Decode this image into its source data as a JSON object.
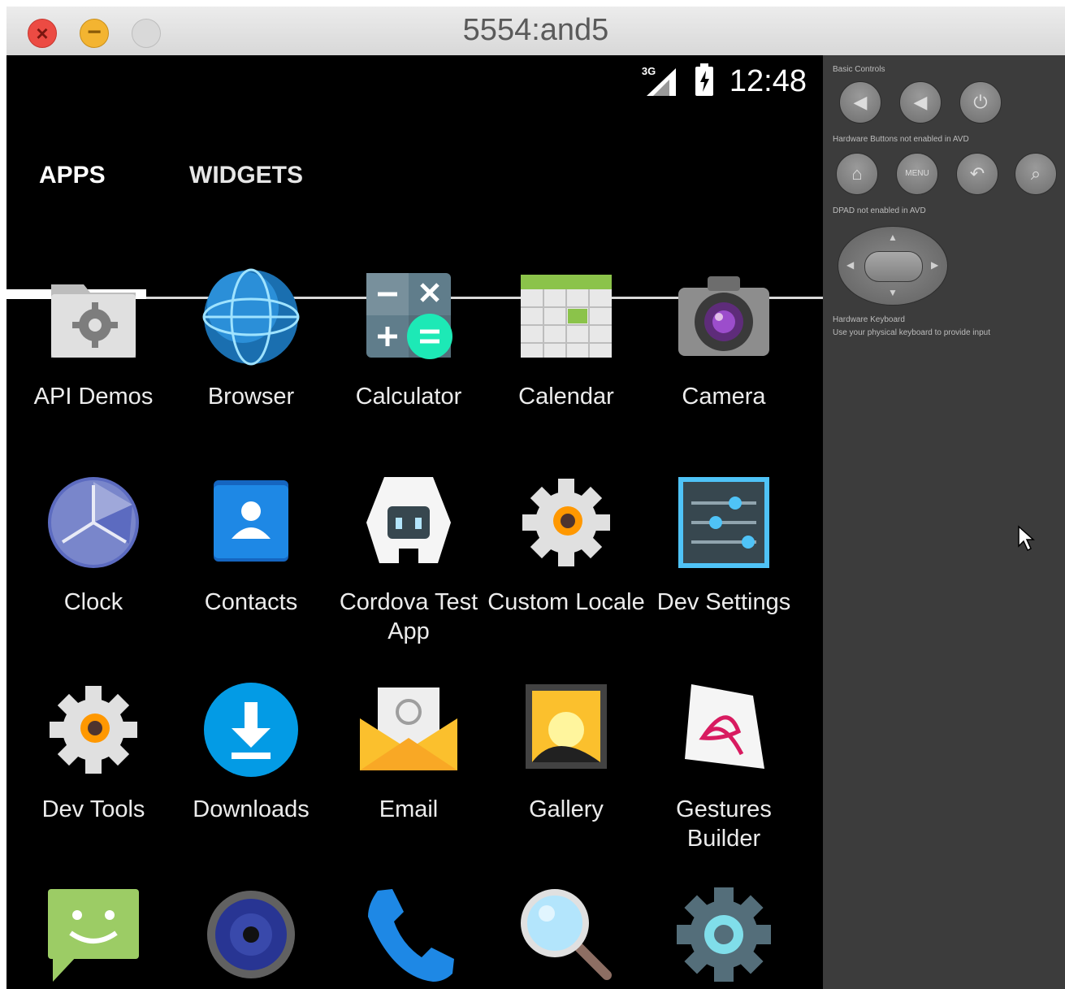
{
  "window": {
    "title": "5554:and5",
    "close_glyph": "×",
    "minimize_glyph": "−"
  },
  "statusbar": {
    "network": "3G",
    "time": "12:48"
  },
  "tabs": [
    {
      "label": "APPS",
      "selected": true
    },
    {
      "label": "WIDGETS",
      "selected": false
    }
  ],
  "apps": [
    {
      "label": "API Demos",
      "icon": "folder-gear-icon"
    },
    {
      "label": "Browser",
      "icon": "globe-icon"
    },
    {
      "label": "Calculator",
      "icon": "calculator-icon"
    },
    {
      "label": "Calendar",
      "icon": "calendar-icon"
    },
    {
      "label": "Camera",
      "icon": "camera-icon"
    },
    {
      "label": "Clock",
      "icon": "clock-icon"
    },
    {
      "label": "Contacts",
      "icon": "contacts-icon"
    },
    {
      "label": "Cordova Test App",
      "icon": "cordova-icon"
    },
    {
      "label": "Custom Locale",
      "icon": "gear-icon"
    },
    {
      "label": "Dev Settings",
      "icon": "sliders-icon"
    },
    {
      "label": "Dev Tools",
      "icon": "gear-icon"
    },
    {
      "label": "Downloads",
      "icon": "download-icon"
    },
    {
      "label": "Email",
      "icon": "email-icon"
    },
    {
      "label": "Gallery",
      "icon": "gallery-icon"
    },
    {
      "label": "Gestures Builder",
      "icon": "gestures-icon"
    },
    {
      "label": "",
      "icon": "messaging-icon"
    },
    {
      "label": "",
      "icon": "music-icon"
    },
    {
      "label": "",
      "icon": "phone-icon"
    },
    {
      "label": "",
      "icon": "search-icon"
    },
    {
      "label": "",
      "icon": "settings-icon"
    }
  ],
  "panel": {
    "basic_controls_label": "Basic Controls",
    "hardware_buttons_label": "Hardware Buttons not enabled in AVD",
    "dpad_label": "DPAD not enabled in AVD",
    "keyboard_label": "Hardware Keyboard",
    "keyboard_hint": "Use your physical keyboard to provide input",
    "basic_buttons": [
      {
        "name": "volume-down-icon",
        "glyph": "◀"
      },
      {
        "name": "volume-up-icon",
        "glyph": "◀"
      },
      {
        "name": "power-icon",
        "glyph": "⏻"
      }
    ],
    "hw_buttons": [
      {
        "name": "home-icon",
        "glyph": "⌂"
      },
      {
        "name": "menu-icon",
        "glyph": "MENU"
      },
      {
        "name": "back-icon",
        "glyph": "↶"
      },
      {
        "name": "search-icon",
        "glyph": "⌕"
      }
    ],
    "dpad_glyphs": {
      "up": "▲",
      "down": "▼",
      "left": "◀",
      "right": "▶"
    }
  }
}
